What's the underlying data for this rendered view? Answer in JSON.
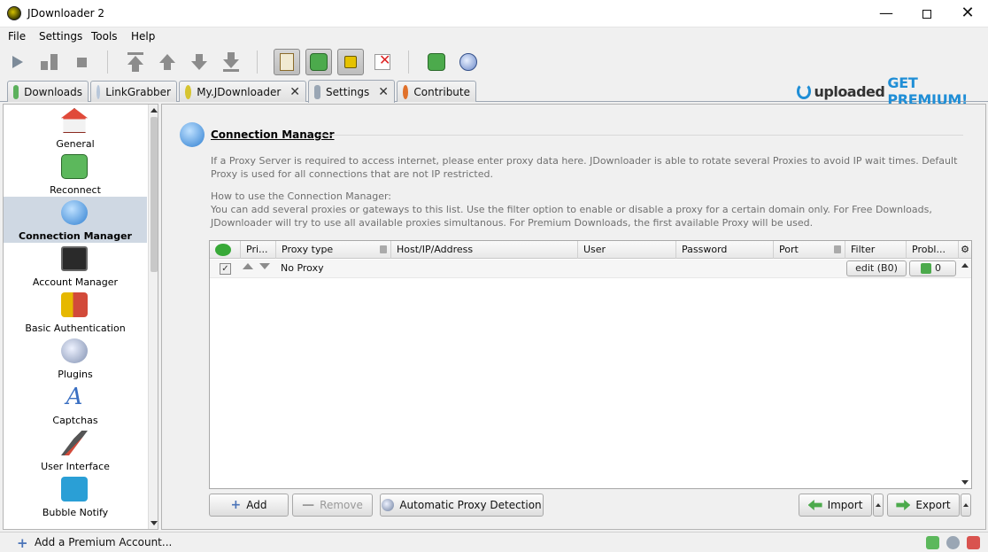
{
  "window": {
    "title": "JDownloader 2"
  },
  "menu": [
    "File",
    "Settings",
    "Tools",
    "Help"
  ],
  "toolbar": {
    "buttons": [
      "start-downloads",
      "pause-downloads",
      "stop-downloads",
      "move-to-top",
      "move-up",
      "move-down",
      "move-to-bottom",
      "clipboard-observer",
      "auto-reconnect",
      "premium-toggle",
      "silent-mode",
      "reconnect-now",
      "update-check"
    ]
  },
  "tabs": [
    {
      "label": "Downloads",
      "closable": false
    },
    {
      "label": "LinkGrabber",
      "closable": false
    },
    {
      "label": "My.JDownloader",
      "closable": true
    },
    {
      "label": "Settings",
      "closable": true,
      "active": true
    },
    {
      "label": "Contribute",
      "closable": false
    }
  ],
  "banner": {
    "brand": "uploaded",
    "cta": "GET PREMIUM!",
    "brand_color": "#1f8ed6"
  },
  "sidebar": {
    "items": [
      {
        "label": "General",
        "icon": "house-icon"
      },
      {
        "label": "Reconnect",
        "icon": "reconnect-icon"
      },
      {
        "label": "Connection Manager",
        "icon": "connection-manager-icon",
        "selected": true
      },
      {
        "label": "Account Manager",
        "icon": "account-lock-icon"
      },
      {
        "label": "Basic Authentication",
        "icon": "keys-user-icon"
      },
      {
        "label": "Plugins",
        "icon": "plugin-globe-icon"
      },
      {
        "label": "Captchas",
        "icon": "captcha-letter-icon"
      },
      {
        "label": "User Interface",
        "icon": "brush-icon"
      },
      {
        "label": "Bubble Notify",
        "icon": "speech-bubble-icon"
      }
    ]
  },
  "content": {
    "title": "Connection Manager",
    "description": "If a Proxy Server is required to access internet, please enter proxy data here. JDownloader is able to rotate several Proxies to avoid IP wait times. Default Proxy is used for all connections that are not IP restricted.",
    "howto_title": "How to use the Connection Manager:",
    "howto_text": "You can add several proxies or gateways to this list. Use the filter option to enable or disable a proxy for a certain domain only. For Free Downloads, JDownloader will try to use all available proxies simultanous. For Premium Downloads, the first available Proxy will be used.",
    "table": {
      "columns": [
        "Pri...",
        "Proxy type",
        "Host/IP/Address",
        "User",
        "Password",
        "Port",
        "Filter",
        "Probl..."
      ],
      "rows": [
        {
          "enabled": true,
          "proxy_type": "No Proxy",
          "host": "",
          "user": "",
          "password": "",
          "port": "",
          "filter": "edit (B0)",
          "problems": "0"
        }
      ]
    },
    "buttons": {
      "add": "Add",
      "remove": "Remove",
      "auto_detect": "Automatic Proxy Detection",
      "import": "Import",
      "export": "Export"
    }
  },
  "statusbar": {
    "add_premium": "Add a Premium Account..."
  }
}
